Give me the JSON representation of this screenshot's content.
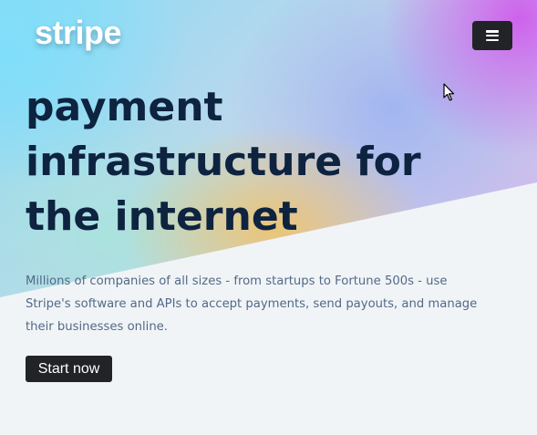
{
  "header": {
    "logo_text": "stripe",
    "menu_icon": "hamburger-menu-icon"
  },
  "hero": {
    "headline": "payment infrastructure for the internet",
    "description": "Millions of companies of all sizes - from startups to Fortune 500s - use Stripe's software and APIs to accept payments, send payouts, and manage their businesses online.",
    "cta_label": "Start now"
  },
  "colors": {
    "headline": "#0d2340",
    "description": "#516a86",
    "button_bg": "#222326",
    "page_bg": "#f1f4f7"
  }
}
